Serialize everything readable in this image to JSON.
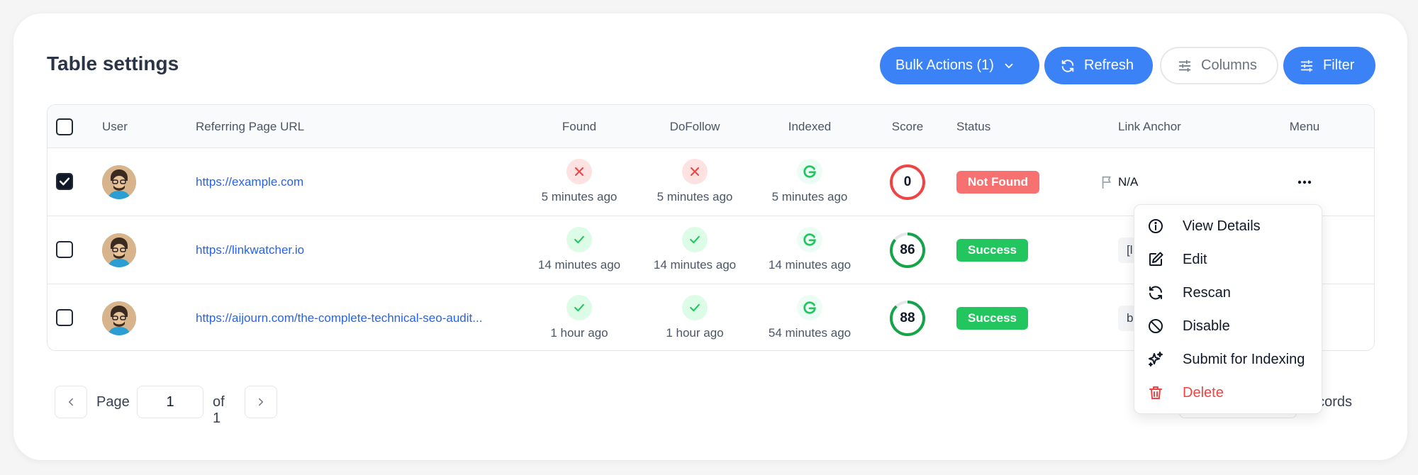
{
  "header": {
    "title": "Table settings",
    "bulk_actions_label": "Bulk Actions (1)",
    "refresh_label": "Refresh",
    "columns_label": "Columns",
    "filter_label": "Filter"
  },
  "table": {
    "columns": {
      "user": "User",
      "url": "Referring Page URL",
      "found": "Found",
      "dofollow": "DoFollow",
      "indexed": "Indexed",
      "score": "Score",
      "status": "Status",
      "anchor": "Link Anchor",
      "menu": "Menu"
    },
    "rows": [
      {
        "selected": true,
        "url": "https://example.com",
        "found": {
          "ok": false,
          "time": "5 minutes ago"
        },
        "dofollow": {
          "ok": false,
          "time": "5 minutes ago"
        },
        "indexed": {
          "time": "5 minutes ago"
        },
        "score": 0,
        "status": "Not Found",
        "anchor": "N/A"
      },
      {
        "selected": false,
        "url": "https://linkwatcher.io",
        "found": {
          "ok": true,
          "time": "14 minutes ago"
        },
        "dofollow": {
          "ok": true,
          "time": "14 minutes ago"
        },
        "indexed": {
          "time": "14 minutes ago"
        },
        "score": 86,
        "status": "Success",
        "anchor": "[l"
      },
      {
        "selected": false,
        "url": "https://aijourn.com/the-complete-technical-seo-audit...",
        "found": {
          "ok": true,
          "time": "1 hour ago"
        },
        "dofollow": {
          "ok": true,
          "time": "1 hour ago"
        },
        "indexed": {
          "time": "54 minutes ago"
        },
        "score": 88,
        "status": "Success",
        "anchor": "b"
      }
    ]
  },
  "context_menu": {
    "items": [
      "View Details",
      "Edit",
      "Rescan",
      "Disable",
      "Submit for Indexing",
      "Delete"
    ]
  },
  "pagination": {
    "page_label": "Page",
    "page_value": "1",
    "of_label": "of 1",
    "records_label": "ecords"
  },
  "colors": {
    "primary": "#3b82f6",
    "success": "#22c55e",
    "danger": "#f87171",
    "link": "#2563eb"
  }
}
